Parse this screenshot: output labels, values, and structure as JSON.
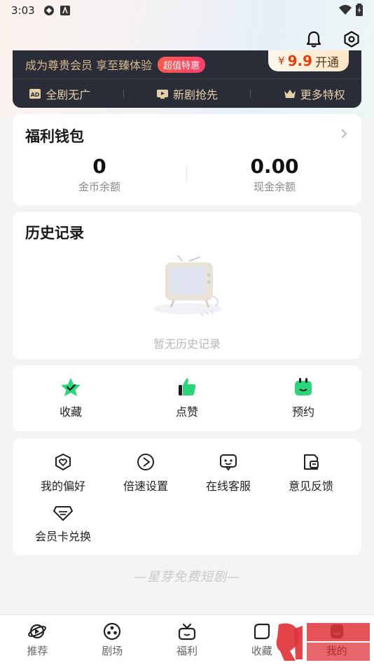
{
  "status_bar": {
    "time": "3:03"
  },
  "vip": {
    "slogan": "成为尊贵会员 享至臻体验",
    "badge": "超值特惠",
    "price_currency": "¥",
    "price_value": "9.9",
    "price_action": "开通",
    "perks": [
      {
        "label": "全剧无广",
        "icon": "ad-free-icon"
      },
      {
        "label": "新剧抢先",
        "icon": "new-episode-icon"
      },
      {
        "label": "更多特权",
        "icon": "crown-icon"
      }
    ]
  },
  "wallet": {
    "title": "福利钱包",
    "coins_value": "0",
    "coins_label": "金币余额",
    "cash_value": "0.00",
    "cash_label": "现金余额"
  },
  "history": {
    "title": "历史记录",
    "empty_text": "暂无历史记录"
  },
  "quick_actions": [
    {
      "label": "收藏",
      "icon": "star-icon"
    },
    {
      "label": "点赞",
      "icon": "thumb-up-icon"
    },
    {
      "label": "预约",
      "icon": "calendar-icon"
    }
  ],
  "tools": [
    {
      "label": "我的偏好",
      "icon": "heart-shield-icon"
    },
    {
      "label": "倍速设置",
      "icon": "speed-icon"
    },
    {
      "label": "在线客服",
      "icon": "chat-bot-icon"
    },
    {
      "label": "意见反馈",
      "icon": "feedback-icon"
    },
    {
      "label": "会员卡兑换",
      "icon": "diamond-card-icon"
    }
  ],
  "footer_brand": "—星芽免费短剧—",
  "tabs": [
    {
      "label": "推荐",
      "icon": "planet-icon"
    },
    {
      "label": "剧场",
      "icon": "film-reel-icon"
    },
    {
      "label": "福利",
      "icon": "gift-icon"
    },
    {
      "label": "收藏",
      "icon": "bookmark-icon"
    },
    {
      "label": "我的",
      "icon": "profile-icon"
    }
  ],
  "colors": {
    "vip_bg": "#2a2d38",
    "vip_gold": "#d8b98e",
    "badge_red": "#ff4a5a",
    "price_orange": "#e0400f",
    "quick_green": "#2bd67b"
  }
}
